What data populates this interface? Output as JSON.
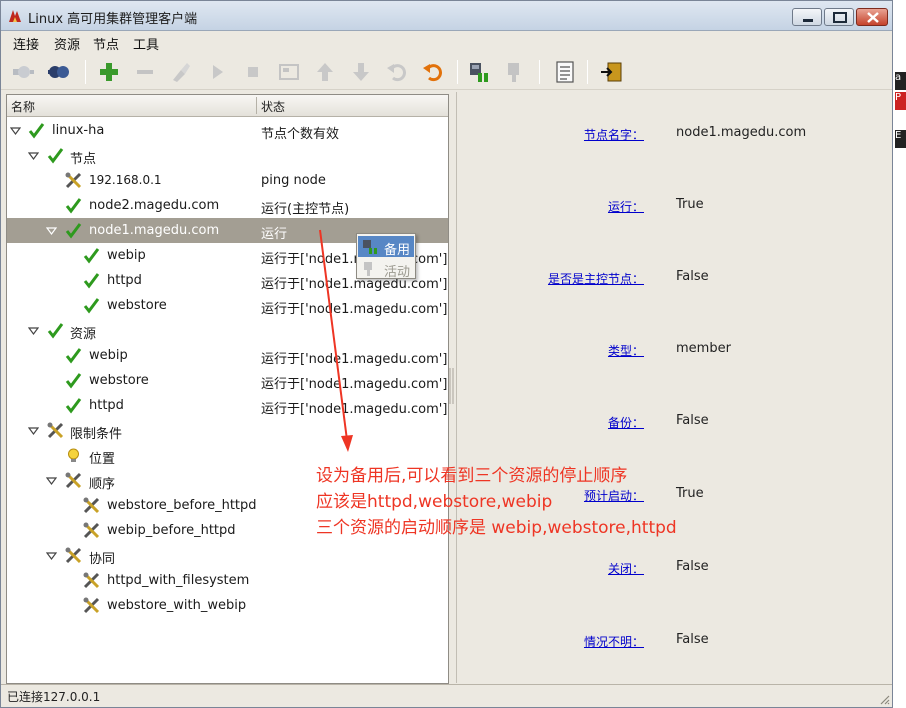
{
  "window": {
    "title": "Linux 高可用集群管理客户端"
  },
  "menu": [
    "连接",
    "资源",
    "节点",
    "工具"
  ],
  "tree": {
    "col_name": "名称",
    "col_status": "状态",
    "rows": [
      {
        "name": "linux-ha",
        "status": "节点个数有效"
      },
      {
        "name": "节点",
        "status": ""
      },
      {
        "name": "192.168.0.1",
        "status": "ping node"
      },
      {
        "name": "node2.magedu.com",
        "status": "运行(主控节点)"
      },
      {
        "name": "node1.magedu.com",
        "status": "运行"
      },
      {
        "name": "webip",
        "status": "运行于['node1.magedu.com']"
      },
      {
        "name": "httpd",
        "status": "运行于['node1.magedu.com']"
      },
      {
        "name": "webstore",
        "status": "运行于['node1.magedu.com']"
      },
      {
        "name": "资源",
        "status": ""
      },
      {
        "name": "webip",
        "status": "运行于['node1.magedu.com']"
      },
      {
        "name": "webstore",
        "status": "运行于['node1.magedu.com']"
      },
      {
        "name": "httpd",
        "status": "运行于['node1.magedu.com']"
      },
      {
        "name": "限制条件",
        "status": ""
      },
      {
        "name": "位置",
        "status": ""
      },
      {
        "name": "顺序",
        "status": ""
      },
      {
        "name": "webstore_before_httpd",
        "status": ""
      },
      {
        "name": "webip_before_httpd",
        "status": ""
      },
      {
        "name": "协同",
        "status": ""
      },
      {
        "name": "httpd_with_filesystem",
        "status": ""
      },
      {
        "name": "webstore_with_webip",
        "status": ""
      }
    ]
  },
  "popup": {
    "standby_label": "备用",
    "active_label": "活动"
  },
  "detail": [
    {
      "label": "节点名字：",
      "value": "node1.magedu.com"
    },
    {
      "label": "运行：",
      "value": "True"
    },
    {
      "label": "是否是主控节点：",
      "value": "False"
    },
    {
      "label": "类型：",
      "value": "member"
    },
    {
      "label": "备份：",
      "value": "False"
    },
    {
      "label": "预计启动：",
      "value": "True"
    },
    {
      "label": "关闭：",
      "value": "False"
    },
    {
      "label": "情况不明：",
      "value": "False"
    }
  ],
  "status_bar": "已连接127.0.0.1",
  "annotation": [
    "设为备用后,可以看到三个资源的停止顺序",
    "应该是httpd,webstore,webip",
    "三个资源的启动顺序是 webip,webstore,httpd"
  ],
  "background_chips": [
    "a",
    "P",
    "E"
  ],
  "colors": {
    "selection": "#a39e93",
    "link": "#0000cc",
    "annotation": "#ee3524",
    "ok_check": "#2e9a1e"
  }
}
